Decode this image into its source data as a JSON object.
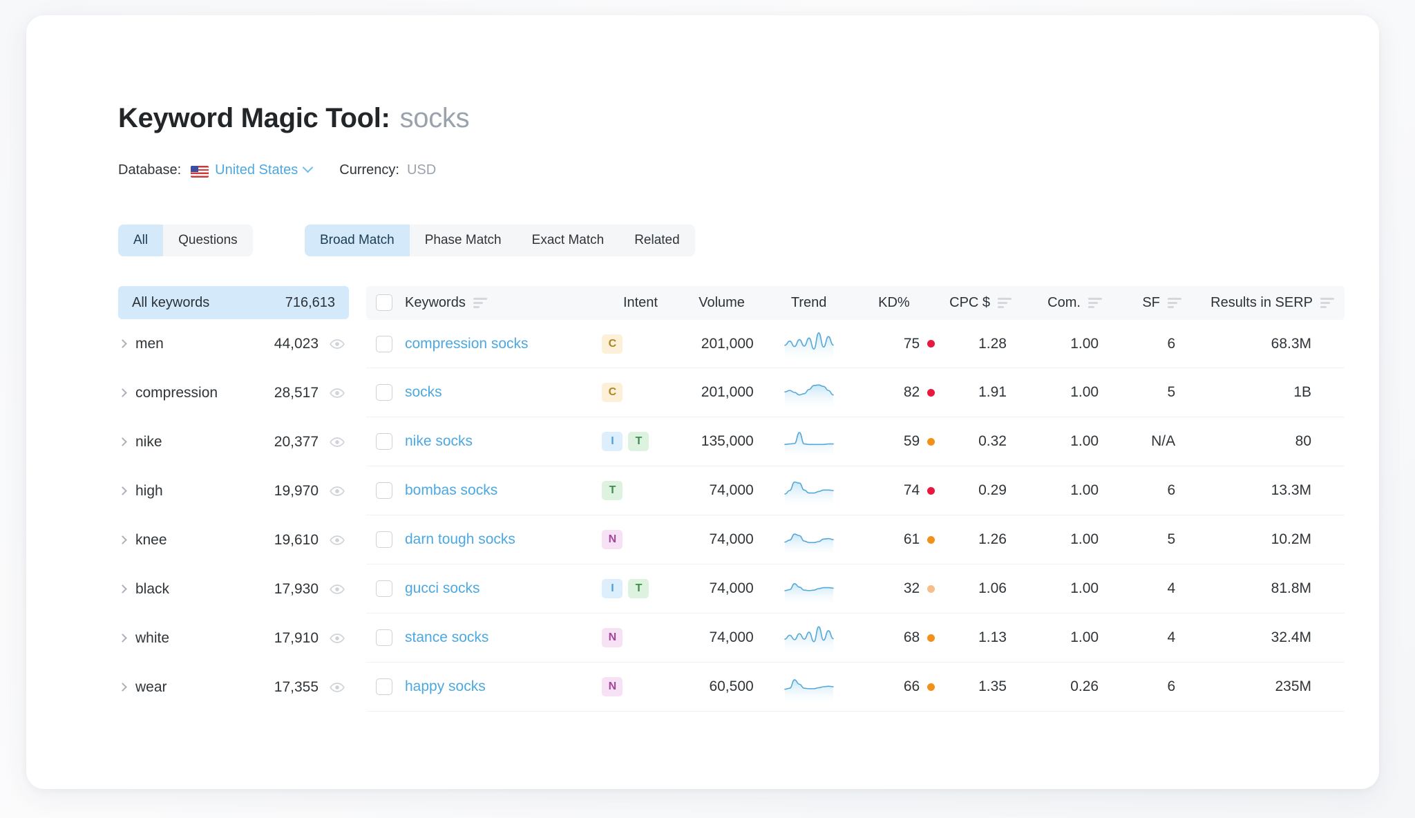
{
  "header": {
    "title": "Keyword Magic Tool:",
    "query": "socks",
    "database_label": "Database:",
    "database_value": "United States",
    "currency_label": "Currency:",
    "currency_value": "USD"
  },
  "tabs_type": [
    {
      "label": "All",
      "active": true
    },
    {
      "label": "Questions",
      "active": false
    }
  ],
  "tabs_match": [
    {
      "label": "Broad Match",
      "active": true
    },
    {
      "label": "Phase Match",
      "active": false
    },
    {
      "label": "Exact Match",
      "active": false
    },
    {
      "label": "Related",
      "active": false
    }
  ],
  "sidebar": {
    "head_label": "All  keywords",
    "head_count": "716,613",
    "items": [
      {
        "label": "men",
        "count": "44,023"
      },
      {
        "label": "compression",
        "count": "28,517"
      },
      {
        "label": "nike",
        "count": "20,377"
      },
      {
        "label": "high",
        "count": "19,970"
      },
      {
        "label": "knee",
        "count": "19,610"
      },
      {
        "label": "black",
        "count": "17,930"
      },
      {
        "label": "white",
        "count": "17,910"
      },
      {
        "label": "wear",
        "count": "17,355"
      }
    ]
  },
  "table": {
    "columns": [
      {
        "key": "keywords",
        "label": "Keywords",
        "sortable": true
      },
      {
        "key": "intent",
        "label": "Intent",
        "sortable": false
      },
      {
        "key": "volume",
        "label": "Volume",
        "sortable": false
      },
      {
        "key": "trend",
        "label": "Trend",
        "sortable": false
      },
      {
        "key": "kd",
        "label": "KD%",
        "sortable": false
      },
      {
        "key": "cpc",
        "label": "CPC $",
        "sortable": true
      },
      {
        "key": "com",
        "label": "Com.",
        "sortable": true
      },
      {
        "key": "sf",
        "label": "SF",
        "sortable": true
      },
      {
        "key": "results",
        "label": "Results in SERP",
        "sortable": true
      }
    ],
    "rows": [
      {
        "keyword": "compression socks",
        "intent": [
          "C"
        ],
        "volume": "201,000",
        "kd": "75",
        "kd_color": "#e8183f",
        "cpc": "1.28",
        "com": "1.00",
        "sf": "6",
        "results": "68.3M",
        "trend": [
          0.45,
          0.62,
          0.4,
          0.68,
          0.42,
          0.74,
          0.3,
          0.95,
          0.38,
          0.8,
          0.46
        ]
      },
      {
        "keyword": "socks",
        "intent": [
          "C"
        ],
        "volume": "201,000",
        "kd": "82",
        "kd_color": "#e8183f",
        "cpc": "1.91",
        "com": "1.00",
        "sf": "5",
        "results": "1B",
        "trend": [
          0.52,
          0.58,
          0.5,
          0.4,
          0.45,
          0.62,
          0.78,
          0.8,
          0.74,
          0.58,
          0.4
        ]
      },
      {
        "keyword": "nike socks",
        "intent": [
          "I",
          "T"
        ],
        "volume": "135,000",
        "kd": "59",
        "kd_color": "#f39019",
        "cpc": "0.32",
        "com": "1.00",
        "sf": "N/A",
        "results": "80",
        "trend": [
          0.38,
          0.4,
          0.42,
          0.86,
          0.4,
          0.38,
          0.38,
          0.38,
          0.38,
          0.4,
          0.4
        ]
      },
      {
        "keyword": "bombas socks",
        "intent": [
          "T"
        ],
        "volume": "74,000",
        "kd": "74",
        "kd_color": "#e8183f",
        "cpc": "0.29",
        "com": "1.00",
        "sf": "6",
        "results": "13.3M",
        "trend": [
          0.36,
          0.5,
          0.84,
          0.8,
          0.52,
          0.4,
          0.4,
          0.46,
          0.52,
          0.52,
          0.5
        ]
      },
      {
        "keyword": "darn tough socks",
        "intent": [
          "N"
        ],
        "volume": "74,000",
        "kd": "61",
        "kd_color": "#f39019",
        "cpc": "1.26",
        "com": "1.00",
        "sf": "5",
        "results": "10.2M",
        "trend": [
          0.4,
          0.48,
          0.72,
          0.66,
          0.44,
          0.38,
          0.38,
          0.42,
          0.52,
          0.54,
          0.5
        ]
      },
      {
        "keyword": "gucci socks",
        "intent": [
          "I",
          "T"
        ],
        "volume": "74,000",
        "kd": "32",
        "kd_color": "#f7bd8a",
        "cpc": "1.06",
        "com": "1.00",
        "sf": "4",
        "results": "81.8M",
        "trend": [
          0.42,
          0.46,
          0.7,
          0.56,
          0.44,
          0.42,
          0.44,
          0.5,
          0.54,
          0.54,
          0.52
        ]
      },
      {
        "keyword": "stance socks",
        "intent": [
          "N"
        ],
        "volume": "74,000",
        "kd": "68",
        "kd_color": "#f39019",
        "cpc": "1.13",
        "com": "1.00",
        "sf": "4",
        "results": "32.4M",
        "trend": [
          0.44,
          0.6,
          0.42,
          0.66,
          0.44,
          0.72,
          0.34,
          0.94,
          0.4,
          0.78,
          0.46
        ]
      },
      {
        "keyword": "happy socks",
        "intent": [
          "N"
        ],
        "volume": "60,500",
        "kd": "66",
        "kd_color": "#f39019",
        "cpc": "1.35",
        "com": "0.26",
        "sf": "6",
        "results": "235M",
        "trend": [
          0.4,
          0.44,
          0.78,
          0.6,
          0.44,
          0.42,
          0.42,
          0.46,
          0.5,
          0.52,
          0.5
        ]
      }
    ]
  },
  "colors": {
    "accent_blue": "#4ca8e0",
    "tab_active_bg": "#d4e9fa",
    "spark_line": "#55a8d8"
  },
  "icons": {
    "sidebar_expand": "chevron-right-icon",
    "sidebar_preview": "eye-icon",
    "db_dropdown": "chevron-down-icon",
    "sort": "sort-desc-icon",
    "select_all": "checkbox-icon"
  }
}
